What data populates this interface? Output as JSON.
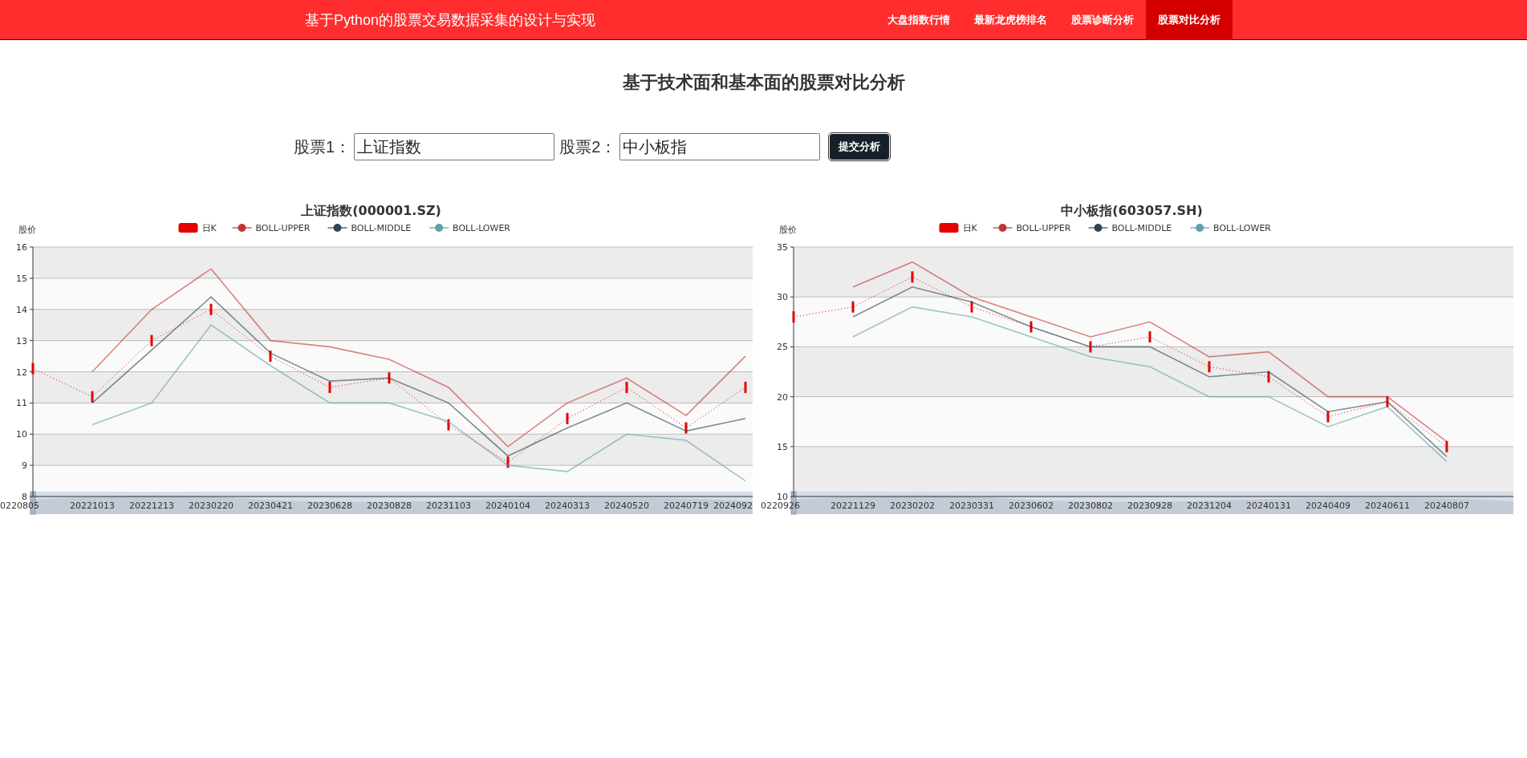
{
  "header": {
    "title": "基于Python的股票交易数据采集的设计与实现",
    "nav": [
      {
        "label": "大盘指数行情",
        "selected": false
      },
      {
        "label": "最新龙虎榜排名",
        "selected": false
      },
      {
        "label": "股票诊断分析",
        "selected": false
      },
      {
        "label": "股票对比分析",
        "selected": true
      }
    ]
  },
  "page_title": "基于技术面和基本面的股票对比分析",
  "form": {
    "fields": [
      {
        "label": "股票1：",
        "value": "上证指数"
      },
      {
        "label": "股票2：",
        "value": "中小板指"
      }
    ],
    "submit": "提交分析"
  },
  "charts": [
    {
      "chart_data": {
        "type": "line",
        "grid": true,
        "legend": true,
        "title": "上证指数(000001.SZ)",
        "ylabel": "股价",
        "categories": [
          "0220805",
          "20221013",
          "20221213",
          "20230220",
          "20230421",
          "20230628",
          "20230828",
          "20231103",
          "20240104",
          "20240313",
          "20240520",
          "20240719",
          "2024092"
        ],
        "ylim": [
          8,
          16
        ],
        "yticks": [
          8,
          9,
          10,
          11,
          12,
          13,
          14,
          15,
          16
        ],
        "series": [
          {
            "name": "日K",
            "color": "#e60000",
            "line_style": "dotted",
            "values": [
              12.1,
              11.2,
              13.0,
              14.0,
              12.5,
              11.5,
              11.8,
              10.3,
              9.1,
              10.5,
              11.5,
              10.2,
              11.5
            ]
          },
          {
            "name": "BOLL-UPPER",
            "color": "#c23531",
            "values": [
              null,
              12.0,
              14.0,
              15.3,
              13.0,
              12.8,
              12.4,
              11.5,
              9.6,
              11.0,
              11.8,
              10.6,
              12.5
            ]
          },
          {
            "name": "BOLL-MIDDLE",
            "color": "#2f4554",
            "values": [
              null,
              11.0,
              12.7,
              14.4,
              12.6,
              11.7,
              11.8,
              11.0,
              9.3,
              10.2,
              11.0,
              10.1,
              10.5
            ]
          },
          {
            "name": "BOLL-LOWER",
            "color": "#61a0a8",
            "values": [
              null,
              10.3,
              11.0,
              13.5,
              12.2,
              11.0,
              11.0,
              10.4,
              9.0,
              8.8,
              10.0,
              9.8,
              8.5
            ]
          }
        ]
      }
    },
    {
      "chart_data": {
        "type": "line",
        "grid": true,
        "legend": true,
        "title": "中小板指(603057.SH)",
        "ylabel": "股价",
        "categories": [
          "0220926",
          "20221129",
          "20230202",
          "20230331",
          "20230602",
          "20230802",
          "20230928",
          "20231204",
          "20240131",
          "20240409",
          "20240611",
          "20240807"
        ],
        "ylim": [
          10,
          35
        ],
        "yticks": [
          10,
          15,
          20,
          25,
          30,
          35
        ],
        "series": [
          {
            "name": "日K",
            "color": "#e60000",
            "line_style": "dotted",
            "values": [
              28,
              29,
              32,
              29,
              27,
              25,
              26,
              23,
              22,
              18,
              19.5,
              15
            ]
          },
          {
            "name": "BOLL-UPPER",
            "color": "#c23531",
            "values": [
              null,
              31,
              33.5,
              30,
              28,
              26,
              27.5,
              24,
              24.5,
              20,
              20,
              15.5
            ]
          },
          {
            "name": "BOLL-MIDDLE",
            "color": "#2f4554",
            "values": [
              null,
              28,
              31,
              29.5,
              27,
              25,
              25,
              22,
              22.5,
              18.5,
              19.5,
              14
            ]
          },
          {
            "name": "BOLL-LOWER",
            "color": "#61a0a8",
            "values": [
              null,
              26,
              29,
              28,
              26,
              24,
              23,
              20,
              20,
              17,
              19,
              13.5
            ]
          }
        ]
      }
    }
  ]
}
